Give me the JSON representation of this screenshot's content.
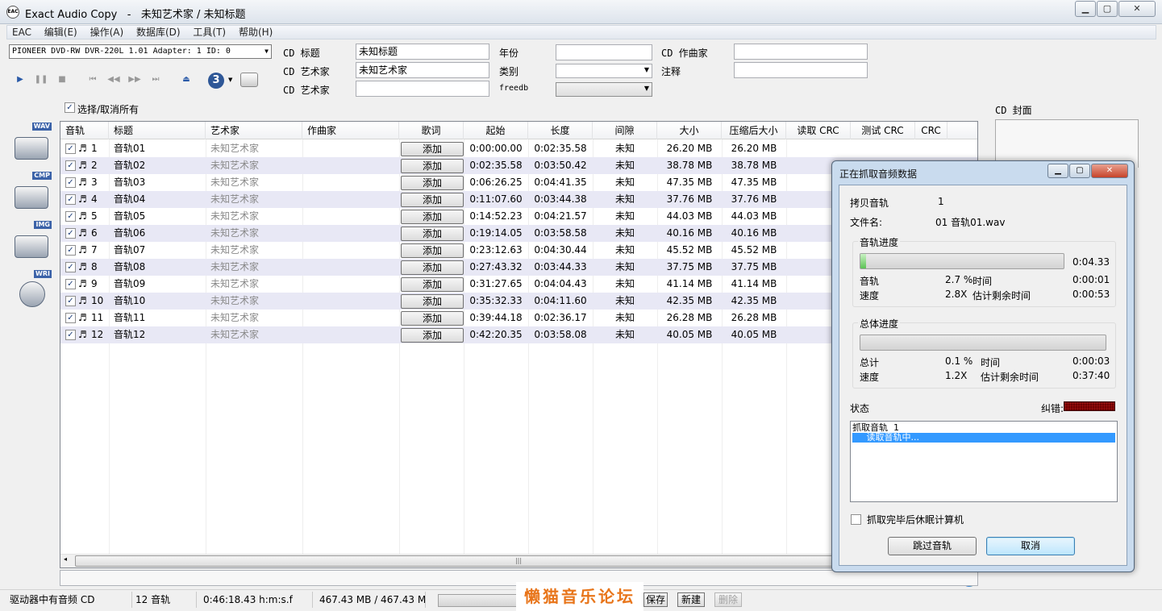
{
  "window": {
    "app_name": "Exact Audio Copy",
    "separator": "-",
    "doc_title": "未知艺术家 / 未知标题",
    "icon_text": "EAC",
    "min_label": "▭",
    "max_label": "□",
    "close_label": "✕"
  },
  "menu": [
    "EAC",
    "编辑(E)",
    "操作(A)",
    "数据库(D)",
    "工具(T)",
    "帮助(H)"
  ],
  "drive": {
    "value": "PIONEER DVD-RW  DVR-220L 1.01   Adapter: 1  ID: 0"
  },
  "toolbar": {
    "speed_number": "3"
  },
  "cd_info": {
    "title_label": "CD 标题",
    "title_value": "未知标题",
    "artist_label": "CD 艺术家",
    "artist_value": "未知艺术家",
    "artist2_label": "CD 艺术家",
    "artist2_value": "",
    "year_label": "年份",
    "year_value": "",
    "genre_label": "类别",
    "genre_value": "",
    "freedb_label": "freedb",
    "composer_label": "CD 作曲家",
    "composer_value": "",
    "comment_label": "注释",
    "comment_value": ""
  },
  "select_all_label": "选择/取消所有",
  "cover_label": "CD 封面",
  "side_icons": [
    "WAV",
    "CMP",
    "IMG",
    "WRI"
  ],
  "table": {
    "columns": [
      "音轨",
      "标题",
      "艺术家",
      "作曲家",
      "歌词",
      "起始",
      "长度",
      "间隙",
      "大小",
      "压缩后大小",
      "读取 CRC",
      "测试 CRC",
      "CRC"
    ],
    "add_label": "添加",
    "rows": [
      {
        "n": "1",
        "title": "音轨01",
        "artist": "未知艺术家",
        "start": "0:00:00.00",
        "length": "0:02:35.58",
        "gap": "未知",
        "size": "26.20 MB",
        "csize": "26.20 MB"
      },
      {
        "n": "2",
        "title": "音轨02",
        "artist": "未知艺术家",
        "start": "0:02:35.58",
        "length": "0:03:50.42",
        "gap": "未知",
        "size": "38.78 MB",
        "csize": "38.78 MB"
      },
      {
        "n": "3",
        "title": "音轨03",
        "artist": "未知艺术家",
        "start": "0:06:26.25",
        "length": "0:04:41.35",
        "gap": "未知",
        "size": "47.35 MB",
        "csize": "47.35 MB"
      },
      {
        "n": "4",
        "title": "音轨04",
        "artist": "未知艺术家",
        "start": "0:11:07.60",
        "length": "0:03:44.38",
        "gap": "未知",
        "size": "37.76 MB",
        "csize": "37.76 MB"
      },
      {
        "n": "5",
        "title": "音轨05",
        "artist": "未知艺术家",
        "start": "0:14:52.23",
        "length": "0:04:21.57",
        "gap": "未知",
        "size": "44.03 MB",
        "csize": "44.03 MB"
      },
      {
        "n": "6",
        "title": "音轨06",
        "artist": "未知艺术家",
        "start": "0:19:14.05",
        "length": "0:03:58.58",
        "gap": "未知",
        "size": "40.16 MB",
        "csize": "40.16 MB"
      },
      {
        "n": "7",
        "title": "音轨07",
        "artist": "未知艺术家",
        "start": "0:23:12.63",
        "length": "0:04:30.44",
        "gap": "未知",
        "size": "45.52 MB",
        "csize": "45.52 MB"
      },
      {
        "n": "8",
        "title": "音轨08",
        "artist": "未知艺术家",
        "start": "0:27:43.32",
        "length": "0:03:44.33",
        "gap": "未知",
        "size": "37.75 MB",
        "csize": "37.75 MB"
      },
      {
        "n": "9",
        "title": "音轨09",
        "artist": "未知艺术家",
        "start": "0:31:27.65",
        "length": "0:04:04.43",
        "gap": "未知",
        "size": "41.14 MB",
        "csize": "41.14 MB"
      },
      {
        "n": "10",
        "title": "音轨10",
        "artist": "未知艺术家",
        "start": "0:35:32.33",
        "length": "0:04:11.60",
        "gap": "未知",
        "size": "42.35 MB",
        "csize": "42.35 MB"
      },
      {
        "n": "11",
        "title": "音轨11",
        "artist": "未知艺术家",
        "start": "0:39:44.18",
        "length": "0:02:36.17",
        "gap": "未知",
        "size": "26.28 MB",
        "csize": "26.28 MB"
      },
      {
        "n": "12",
        "title": "音轨12",
        "artist": "未知艺术家",
        "start": "0:42:20.35",
        "length": "0:03:58.08",
        "gap": "未知",
        "size": "40.05 MB",
        "csize": "40.05 MB"
      }
    ]
  },
  "status_bar": {
    "disc_type": "驱动器中有音频 CD",
    "track_count": "12 音轨",
    "total_time": "0:46:18.43 h:m:s.f",
    "total_size": "467.43 MB / 467.43 M",
    "save_label": "保存",
    "new_label": "新建",
    "delete_label": "删除"
  },
  "watermark": "懒猫音乐论坛",
  "dialog": {
    "title": "正在抓取音频数据",
    "copy_track_label": "拷贝音轨",
    "copy_track_value": "1",
    "filename_label": "文件名:",
    "filename_value": "01 音轨01.wav",
    "track_group": "音轨进度",
    "track_progress_fraction": 0.027,
    "track_duration": "0:04.33",
    "track_label": "音轨",
    "track_pct": "2.7 %",
    "time_label": "时间",
    "track_time": "0:00:01",
    "speed_label": "速度",
    "track_speed": "2.8X",
    "remain_label": "估计剩余时间",
    "track_remain": "0:00:53",
    "total_group": "总体进度",
    "total_progress_fraction": 0.001,
    "total_label": "总计",
    "total_pct": "0.1 %",
    "total_time_label": "时间",
    "total_time": "0:00:03",
    "total_speed_label": "速度",
    "total_speed": "1.2X",
    "total_remain_label": "估计剩余时间",
    "total_remain": "0:37:40",
    "status_label": "状态",
    "error_label": "纠错:",
    "log_line1": "抓取音轨  1",
    "log_line2": "     读取音轨中...",
    "hibernate_label": "抓取完毕后休眠计算机",
    "skip_label": "跳过音轨",
    "cancel_label": "取消"
  }
}
